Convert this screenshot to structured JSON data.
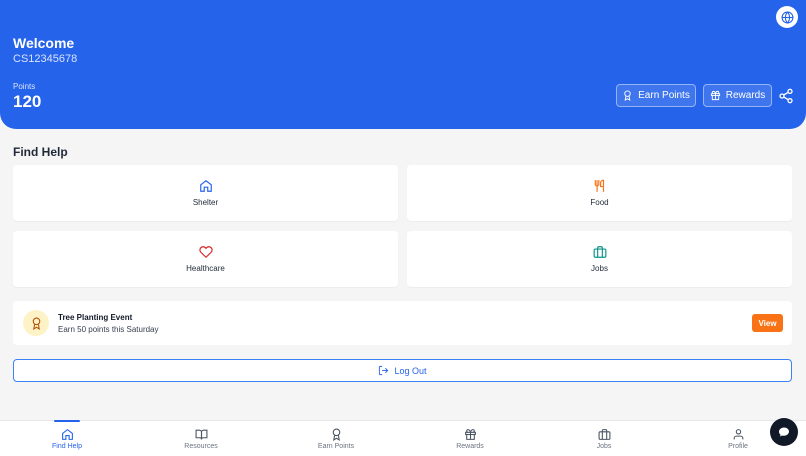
{
  "header": {
    "welcome": "Welcome",
    "user_id": "CS12345678",
    "points_label": "Points",
    "points_value": "120",
    "earn_points_label": "Earn Points",
    "rewards_label": "Rewards",
    "bg_color": "#2563eb"
  },
  "find_help": {
    "title": "Find Help",
    "cards": [
      {
        "label": "Shelter",
        "icon": "home-icon",
        "color": "#2563eb"
      },
      {
        "label": "Food",
        "icon": "utensils-icon",
        "color": "#f97316"
      },
      {
        "label": "Healthcare",
        "icon": "heart-icon",
        "color": "#dc2626"
      },
      {
        "label": "Jobs",
        "icon": "briefcase-icon",
        "color": "#0d9488"
      }
    ]
  },
  "event": {
    "title": "Tree Planting Event",
    "subtitle": "Earn 50 points this Saturday",
    "view_label": "View",
    "icon": "award-icon"
  },
  "logout_label": "Log Out",
  "nav": {
    "items": [
      {
        "label": "Find Help",
        "icon": "home-icon",
        "active": true
      },
      {
        "label": "Resources",
        "icon": "book-icon",
        "active": false
      },
      {
        "label": "Earn Points",
        "icon": "award-icon",
        "active": false
      },
      {
        "label": "Rewards",
        "icon": "gift-icon",
        "active": false
      },
      {
        "label": "Jobs",
        "icon": "briefcase-icon",
        "active": false
      },
      {
        "label": "Profile",
        "icon": "user-icon",
        "active": false
      }
    ]
  }
}
